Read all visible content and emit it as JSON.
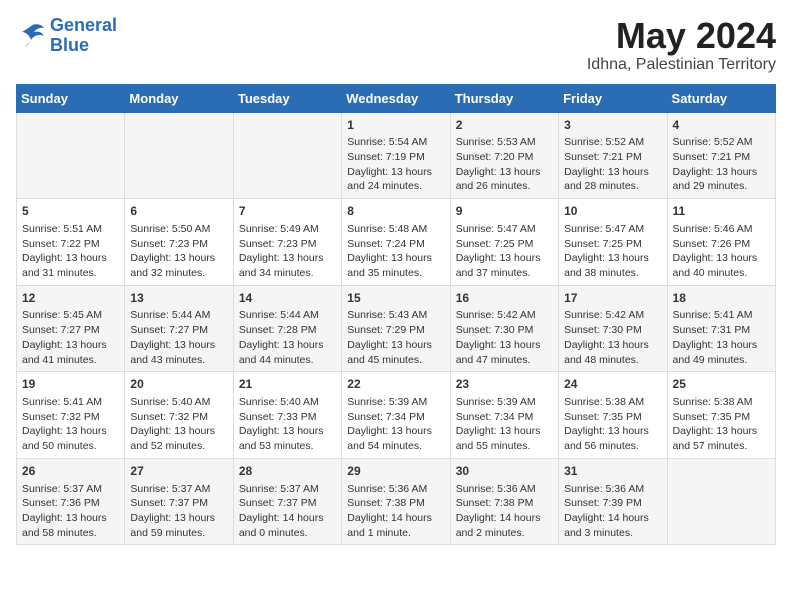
{
  "header": {
    "logo_line1": "General",
    "logo_line2": "Blue",
    "title": "May 2024",
    "subtitle": "Idhna, Palestinian Territory"
  },
  "weekdays": [
    "Sunday",
    "Monday",
    "Tuesday",
    "Wednesday",
    "Thursday",
    "Friday",
    "Saturday"
  ],
  "weeks": [
    [
      {
        "day": "",
        "info": ""
      },
      {
        "day": "",
        "info": ""
      },
      {
        "day": "",
        "info": ""
      },
      {
        "day": "1",
        "info": "Sunrise: 5:54 AM\nSunset: 7:19 PM\nDaylight: 13 hours\nand 24 minutes."
      },
      {
        "day": "2",
        "info": "Sunrise: 5:53 AM\nSunset: 7:20 PM\nDaylight: 13 hours\nand 26 minutes."
      },
      {
        "day": "3",
        "info": "Sunrise: 5:52 AM\nSunset: 7:21 PM\nDaylight: 13 hours\nand 28 minutes."
      },
      {
        "day": "4",
        "info": "Sunrise: 5:52 AM\nSunset: 7:21 PM\nDaylight: 13 hours\nand 29 minutes."
      }
    ],
    [
      {
        "day": "5",
        "info": "Sunrise: 5:51 AM\nSunset: 7:22 PM\nDaylight: 13 hours\nand 31 minutes."
      },
      {
        "day": "6",
        "info": "Sunrise: 5:50 AM\nSunset: 7:23 PM\nDaylight: 13 hours\nand 32 minutes."
      },
      {
        "day": "7",
        "info": "Sunrise: 5:49 AM\nSunset: 7:23 PM\nDaylight: 13 hours\nand 34 minutes."
      },
      {
        "day": "8",
        "info": "Sunrise: 5:48 AM\nSunset: 7:24 PM\nDaylight: 13 hours\nand 35 minutes."
      },
      {
        "day": "9",
        "info": "Sunrise: 5:47 AM\nSunset: 7:25 PM\nDaylight: 13 hours\nand 37 minutes."
      },
      {
        "day": "10",
        "info": "Sunrise: 5:47 AM\nSunset: 7:25 PM\nDaylight: 13 hours\nand 38 minutes."
      },
      {
        "day": "11",
        "info": "Sunrise: 5:46 AM\nSunset: 7:26 PM\nDaylight: 13 hours\nand 40 minutes."
      }
    ],
    [
      {
        "day": "12",
        "info": "Sunrise: 5:45 AM\nSunset: 7:27 PM\nDaylight: 13 hours\nand 41 minutes."
      },
      {
        "day": "13",
        "info": "Sunrise: 5:44 AM\nSunset: 7:27 PM\nDaylight: 13 hours\nand 43 minutes."
      },
      {
        "day": "14",
        "info": "Sunrise: 5:44 AM\nSunset: 7:28 PM\nDaylight: 13 hours\nand 44 minutes."
      },
      {
        "day": "15",
        "info": "Sunrise: 5:43 AM\nSunset: 7:29 PM\nDaylight: 13 hours\nand 45 minutes."
      },
      {
        "day": "16",
        "info": "Sunrise: 5:42 AM\nSunset: 7:30 PM\nDaylight: 13 hours\nand 47 minutes."
      },
      {
        "day": "17",
        "info": "Sunrise: 5:42 AM\nSunset: 7:30 PM\nDaylight: 13 hours\nand 48 minutes."
      },
      {
        "day": "18",
        "info": "Sunrise: 5:41 AM\nSunset: 7:31 PM\nDaylight: 13 hours\nand 49 minutes."
      }
    ],
    [
      {
        "day": "19",
        "info": "Sunrise: 5:41 AM\nSunset: 7:32 PM\nDaylight: 13 hours\nand 50 minutes."
      },
      {
        "day": "20",
        "info": "Sunrise: 5:40 AM\nSunset: 7:32 PM\nDaylight: 13 hours\nand 52 minutes."
      },
      {
        "day": "21",
        "info": "Sunrise: 5:40 AM\nSunset: 7:33 PM\nDaylight: 13 hours\nand 53 minutes."
      },
      {
        "day": "22",
        "info": "Sunrise: 5:39 AM\nSunset: 7:34 PM\nDaylight: 13 hours\nand 54 minutes."
      },
      {
        "day": "23",
        "info": "Sunrise: 5:39 AM\nSunset: 7:34 PM\nDaylight: 13 hours\nand 55 minutes."
      },
      {
        "day": "24",
        "info": "Sunrise: 5:38 AM\nSunset: 7:35 PM\nDaylight: 13 hours\nand 56 minutes."
      },
      {
        "day": "25",
        "info": "Sunrise: 5:38 AM\nSunset: 7:35 PM\nDaylight: 13 hours\nand 57 minutes."
      }
    ],
    [
      {
        "day": "26",
        "info": "Sunrise: 5:37 AM\nSunset: 7:36 PM\nDaylight: 13 hours\nand 58 minutes."
      },
      {
        "day": "27",
        "info": "Sunrise: 5:37 AM\nSunset: 7:37 PM\nDaylight: 13 hours\nand 59 minutes."
      },
      {
        "day": "28",
        "info": "Sunrise: 5:37 AM\nSunset: 7:37 PM\nDaylight: 14 hours\nand 0 minutes."
      },
      {
        "day": "29",
        "info": "Sunrise: 5:36 AM\nSunset: 7:38 PM\nDaylight: 14 hours\nand 1 minute."
      },
      {
        "day": "30",
        "info": "Sunrise: 5:36 AM\nSunset: 7:38 PM\nDaylight: 14 hours\nand 2 minutes."
      },
      {
        "day": "31",
        "info": "Sunrise: 5:36 AM\nSunset: 7:39 PM\nDaylight: 14 hours\nand 3 minutes."
      },
      {
        "day": "",
        "info": ""
      }
    ]
  ]
}
